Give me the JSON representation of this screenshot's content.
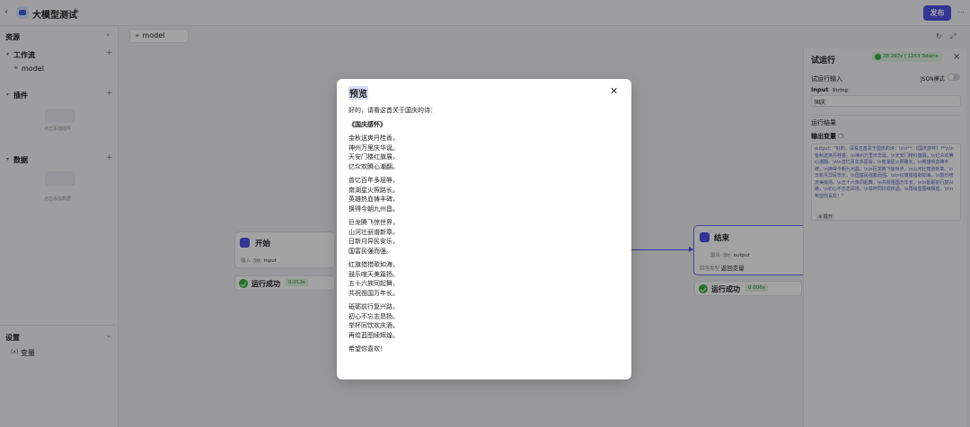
{
  "app": {
    "title": "大模型测试",
    "publish_label": "发布"
  },
  "sidebar": {
    "resources_label": "资源",
    "workflow_label": "工作流",
    "workflow_item": "model",
    "plugins_label": "插件",
    "plugins_empty": "点击添加插件",
    "data_label": "数据",
    "data_empty": "点击添加数据",
    "settings_label": "设置",
    "variables_label": "变量"
  },
  "canvas": {
    "tab_label": "model",
    "start_node": {
      "title": "开始",
      "input_label": "输入",
      "input_type": "Str",
      "input_name": "input",
      "status": "运行成功",
      "time": "0.012s"
    },
    "end_node": {
      "title": "结束",
      "output_label": "输出",
      "output_type": "Str",
      "output_name": "output",
      "var_label": "回答类型",
      "var_value": "返回变量",
      "status": "运行成功",
      "time": "0.006s"
    }
  },
  "run_panel": {
    "title": "试运行",
    "badge": "28.267s | 1263 Tokens",
    "input_section": "试运行输入",
    "json_mode": "JSON模式",
    "input_label": "Input",
    "input_type": "String",
    "input_value": "国庆",
    "result_section": "运行结果",
    "output_var_label": "输出变量",
    "output_text": "output：\"好的，请看这首关于国庆的诗：\\n\\n** 《国庆感怀》**\\n\\n金秋送爽丹桂香，\\n神州万里庆华诞。\\n天安门楼红旗展，\\n亿众欢腾心潮翻。\\n\\n曾忆百年多屈辱，\\n南湖星火照路长。\\n英雄热血铸丰碑，\\n换得今朝九州昌。\\n\\n巨龙腾飞惊世界，\\n山河壮丽谱新章。\\n日新月异民安乐，\\n国富民强繁而强。\\n\\n红旗猎猎歌如海，\\n鼓乐喧天美篇扬。\\n五十六族同起舞，\\n共祝祖国万年长。\\n\\n砥砺前行复兴路，\\n初心不忘志昂扬。\\n举杯同饮欢庆酒，\\n再绘蓝图续辉煌。\\n\\n希望你喜欢！\"",
    "expand_label": "⊕ 展开"
  },
  "modal": {
    "title": "预览",
    "intro": "好的，请看这首关于国庆的诗：",
    "poem_title": "《国庆感怀》",
    "stanzas": [
      [
        "金秋送爽丹桂香，",
        "神州万里庆华诞。",
        "天安门楼红旗展，",
        "亿众欢腾心潮翻。"
      ],
      [
        "曾忆百年多屈辱，",
        "南湖星火照路长。",
        "英雄热血铸丰碑，",
        "换得今朝九州昌。"
      ],
      [
        "巨龙腾飞惊世界，",
        "山河壮丽谱新章。",
        "日新月异民安乐，",
        "国富民强而强。"
      ],
      [
        "红旗猎猎歌如海，",
        "鼓乐喧天美篇扬。",
        "五十六族同起舞，",
        "共祝祖国万年长。"
      ],
      [
        "砥砺前行复兴路，",
        "初心不忘志昂扬。",
        "举杯同饮欢庆酒，",
        "再绘蓝图续辉煌。"
      ]
    ],
    "outro": "希望你喜欢！"
  }
}
